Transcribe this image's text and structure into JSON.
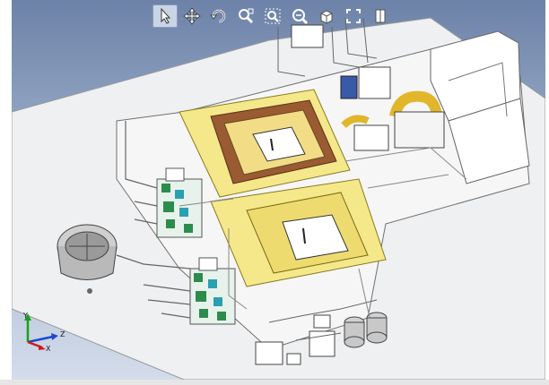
{
  "toolbar": {
    "tools": [
      {
        "name": "select-tool",
        "icon": "cursor-arrow-icon",
        "active": true
      },
      {
        "name": "pan-tool",
        "icon": "pan-arrows-icon",
        "active": false
      },
      {
        "name": "rotate-tool",
        "icon": "rotate-icon",
        "active": false
      },
      {
        "name": "zoom-area-tool",
        "icon": "zoom-area-icon",
        "active": false
      },
      {
        "name": "zoom-fit-tool",
        "icon": "zoom-fit-icon",
        "active": false
      },
      {
        "name": "zoom-tool",
        "icon": "zoom-magnifier-icon",
        "active": false
      },
      {
        "name": "view-orientation-tool",
        "icon": "view-cube-icon",
        "active": false
      },
      {
        "name": "fullscreen-tool",
        "icon": "fullscreen-icon",
        "active": false
      },
      {
        "name": "section-view-tool",
        "icon": "section-view-icon",
        "active": false
      }
    ]
  },
  "triad": {
    "x_label": "X",
    "y_label": "Y",
    "z_label": "Z"
  },
  "colors": {
    "background_top": "#6d82a8",
    "background_bottom": "#d3dcea",
    "floor": "#eef0f2",
    "room_yellow": "#f4e88a",
    "frame_brown": "#9a5a32",
    "duct_yellow": "#e2b62a",
    "equipment_green": "#2c8c4c",
    "tank_gray": "#b9b9b9"
  }
}
